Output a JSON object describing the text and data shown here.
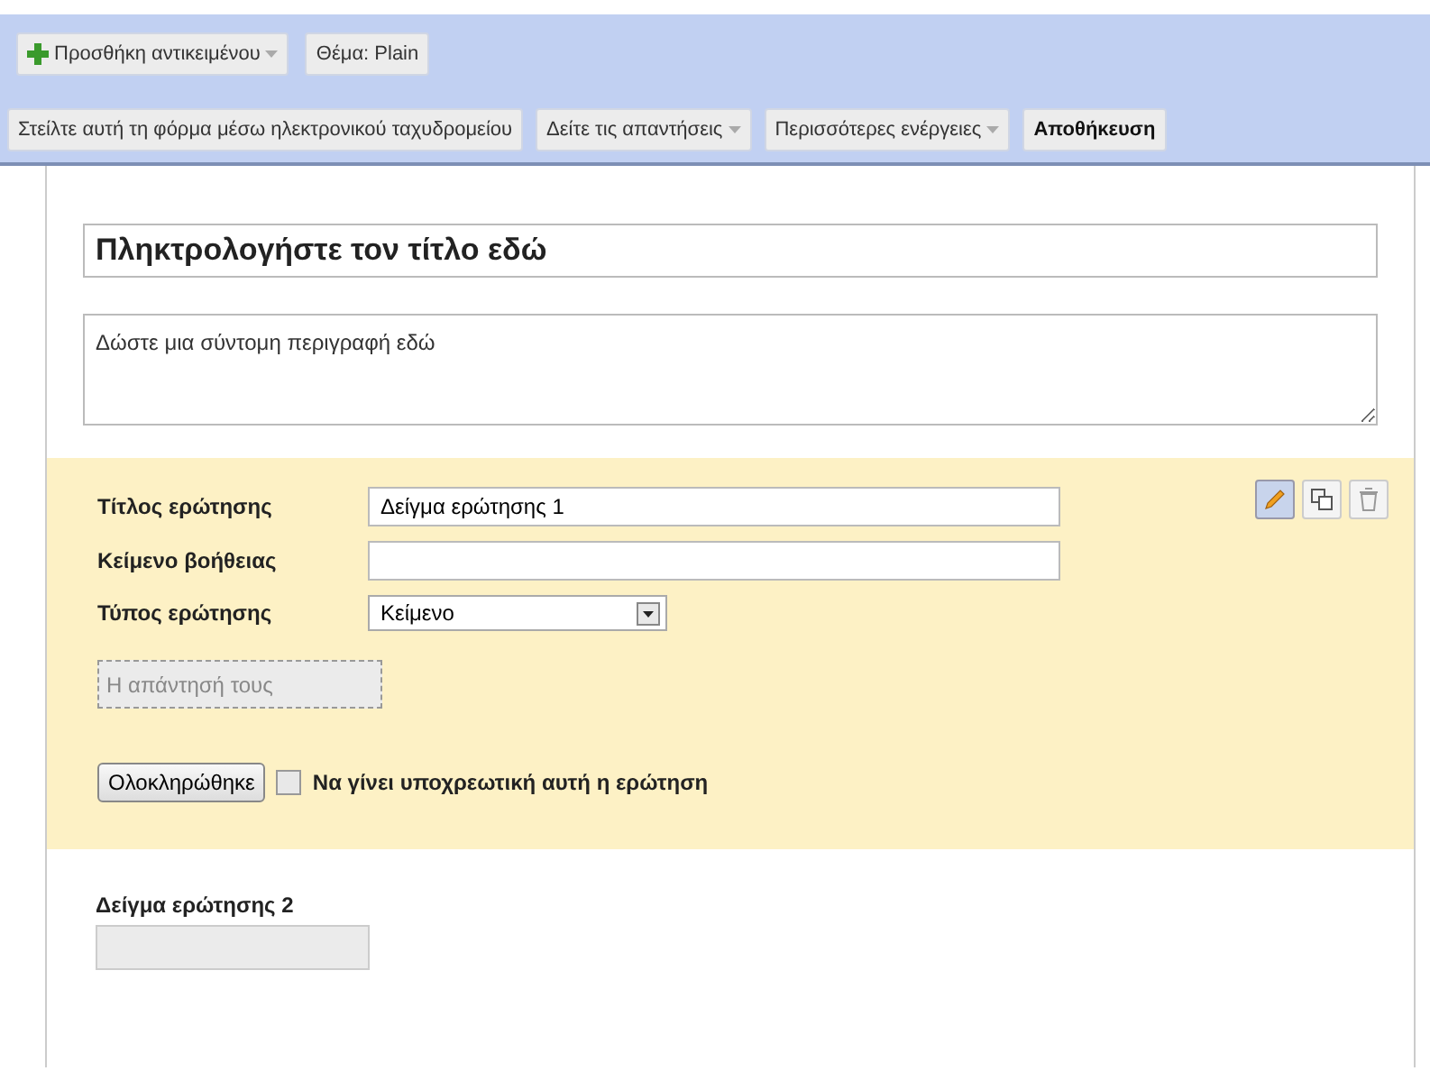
{
  "top_toolbar": [
    {
      "label": "Προσθήκη αντικειμένου",
      "kind": "add_menu"
    },
    {
      "label": "Θέμα: Plain",
      "kind": "plain"
    }
  ],
  "action_toolbar": [
    {
      "label": "Στείλτε αυτή τη φόρμα μέσω ηλεκτρονικού ταχυδρομείου",
      "kind": "plain"
    },
    {
      "label": "Δείτε τις απαντήσεις",
      "kind": "menu"
    },
    {
      "label": "Περισσότερες ενέργειες",
      "kind": "menu"
    },
    {
      "label": "Αποθήκευση",
      "kind": "primary"
    }
  ],
  "form": {
    "title": "Πληκτρολογήστε τον τίτλο εδώ",
    "description": "Δώστε μια σύντομη περιγραφή εδώ"
  },
  "editing_question": {
    "title_label": "Τίτλος ερώτησης",
    "title_value": "Δείγμα ερώτησης 1",
    "help_label": "Κείμενο βοήθειας",
    "type_label": "Τύπος ερώτησης",
    "type_value": "Κείμενο",
    "answer_placeholder": "Η απάντησή τους",
    "done_button": "Ολοκληρώθηκε",
    "required_label": "Να γίνει υποχρεωτική αυτή η ερώτηση",
    "required": false,
    "edit_active": true
  },
  "next_question": {
    "title": "Δείγμα ερώτησης 2"
  }
}
